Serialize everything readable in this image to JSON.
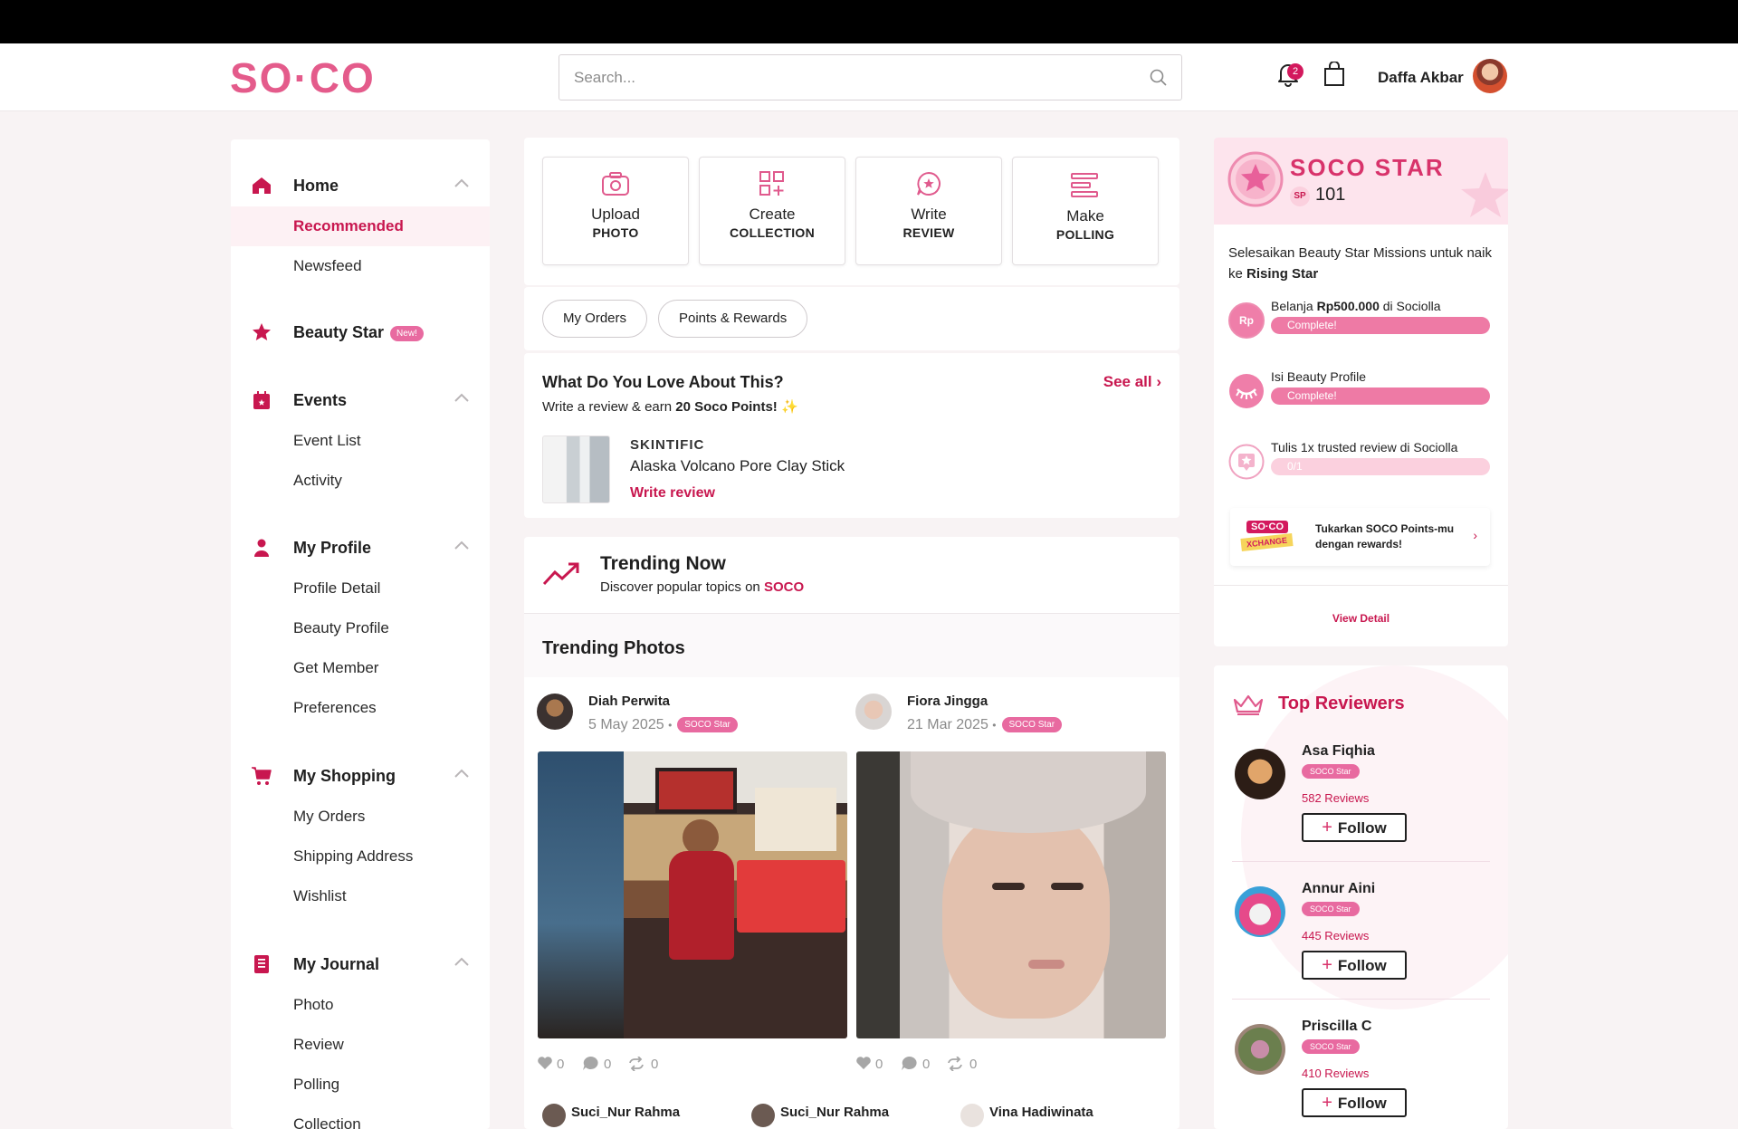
{
  "header": {
    "logo": "SO·CO",
    "search_placeholder": "Search...",
    "notification_count": "2",
    "user_name": "Daffa Akbar"
  },
  "sidebar": {
    "home": {
      "title": "Home",
      "items": [
        "Recommended",
        "Newsfeed"
      ],
      "active": "Recommended"
    },
    "beauty_star": {
      "title": "Beauty Star",
      "badge": "New!"
    },
    "events": {
      "title": "Events",
      "items": [
        "Event List",
        "Activity"
      ]
    },
    "my_profile": {
      "title": "My Profile",
      "items": [
        "Profile Detail",
        "Beauty Profile",
        "Get Member",
        "Preferences"
      ]
    },
    "my_shopping": {
      "title": "My Shopping",
      "items": [
        "My Orders",
        "Shipping Address",
        "Wishlist"
      ]
    },
    "my_journal": {
      "title": "My Journal",
      "items": [
        "Photo",
        "Review",
        "Polling",
        "Collection"
      ]
    }
  },
  "actions": [
    {
      "line1": "Upload",
      "line2": "PHOTO",
      "icon": "camera-icon"
    },
    {
      "line1": "Create",
      "line2": "COLLECTION",
      "icon": "collection-icon"
    },
    {
      "line1": "Write",
      "line2": "REVIEW",
      "icon": "review-icon"
    },
    {
      "line1": "Make",
      "line2": "POLLING",
      "icon": "polling-icon"
    }
  ],
  "pills": [
    "My Orders",
    "Points & Rewards"
  ],
  "love": {
    "title": "What Do You Love About This?",
    "see_all": "See all ›",
    "subtitle_prefix": "Write a review & earn ",
    "subtitle_points": "20 Soco Points!",
    "brand": "SKINTIFIC",
    "product": "Alaska Volcano Pore Clay Stick",
    "write_review": "Write review"
  },
  "trending": {
    "title": "Trending Now",
    "subtitle_prefix": "Discover popular topics on ",
    "subtitle_brand": "SOCO",
    "photos_title": "Trending Photos",
    "posts": [
      {
        "name": "Diah Perwita",
        "date": "5 May 2025",
        "badge": "SOCO Star",
        "likes": "0",
        "comments": "0",
        "shares": "0"
      },
      {
        "name": "Fiora Jingga",
        "date": "21 Mar 2025",
        "badge": "SOCO Star",
        "likes": "0",
        "comments": "0",
        "shares": "0"
      }
    ],
    "more_posters": [
      "Suci_Nur Rahma",
      "Suci_Nur Rahma",
      "Vina Hadiwinata"
    ]
  },
  "soco_star": {
    "title": "SOCO STAR",
    "sp_label": "SP",
    "points": "101",
    "mission_text_prefix": "Selesaikan Beauty Star Missions untuk naik ke ",
    "mission_text_target": "Rising Star",
    "missions": [
      {
        "label_prefix": "Belanja ",
        "label_bold": "Rp500.000",
        "label_suffix": " di Sociolla",
        "status": "Complete!",
        "icon_text": "Rp"
      },
      {
        "label_prefix": "Isi Beauty Profile",
        "label_bold": "",
        "label_suffix": "",
        "status": "Complete!",
        "icon_text": ""
      },
      {
        "label_prefix": "Tulis 1x trusted review di Sociolla",
        "label_bold": "",
        "label_suffix": "",
        "status": "0/1",
        "icon_text": ""
      }
    ],
    "xchange_logo_top": "SO·CO",
    "xchange_logo_bottom": "XCHANGE",
    "xchange_text": "Tukarkan SOCO Points-mu dengan rewards!",
    "view_detail": "View Detail"
  },
  "top_reviewers": {
    "title": "Top Reviewers",
    "follow_label": "Follow",
    "reviewers": [
      {
        "name": "Asa Fiqhia",
        "badge": "SOCO Star",
        "count": "582 Reviews"
      },
      {
        "name": "Annur Aini",
        "badge": "SOCO Star",
        "count": "445 Reviews"
      },
      {
        "name": "Priscilla C",
        "badge": "SOCO Star",
        "count": "410 Reviews"
      }
    ]
  },
  "colors": {
    "accent": "#c8174f",
    "pink": "#e86aa0",
    "soft_pink": "#fde4ed"
  }
}
